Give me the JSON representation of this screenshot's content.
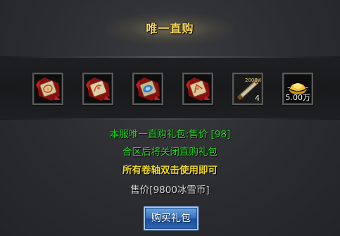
{
  "title": "唯一直购",
  "items": [
    {
      "name": "gift-scroll-red-1-icon",
      "count": ""
    },
    {
      "name": "gift-scroll-red-2-icon",
      "count": ""
    },
    {
      "name": "gift-scroll-blue-icon",
      "count": ""
    },
    {
      "name": "gift-scroll-red-3-icon",
      "count": ""
    },
    {
      "name": "scroll-2000w-icon",
      "label": "2000W",
      "count": "4"
    },
    {
      "name": "gold-ingot-icon",
      "count": "5.00万"
    }
  ],
  "info": {
    "line1": "本服唯一直购礼包:售价 [98]",
    "line2": "合区后将关闭直购礼包",
    "line3": "所有卷轴双击使用即可",
    "price": "售价[9800冰雪币]"
  },
  "buy_button": "购买礼包",
  "colors": {
    "title": "#f6d55a",
    "green_text": "#21d51e",
    "yellow_text": "#f3dc21",
    "button": "#3a74bf"
  }
}
